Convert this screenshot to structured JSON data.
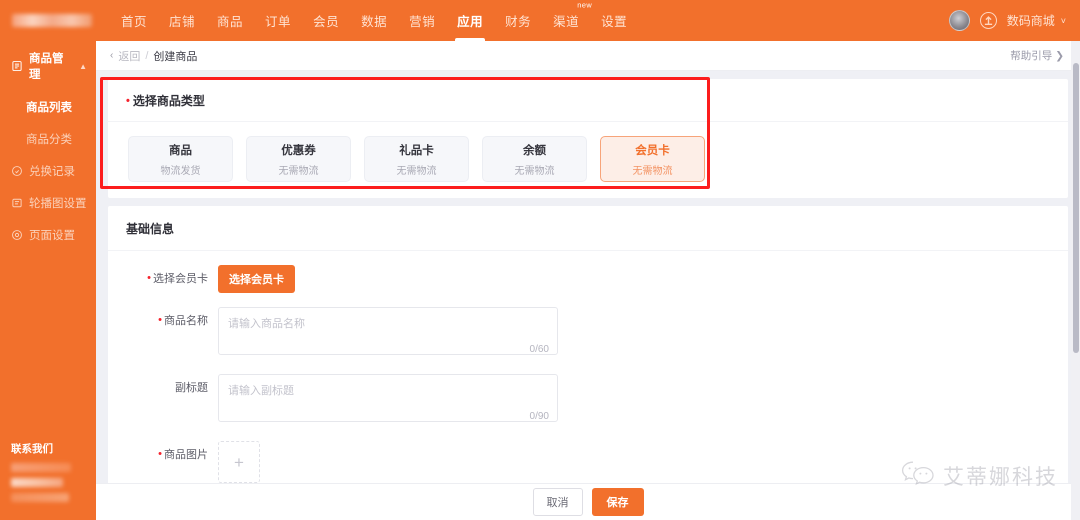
{
  "topbar": {
    "nav": [
      {
        "label": "首页",
        "active": false
      },
      {
        "label": "店铺",
        "active": false
      },
      {
        "label": "商品",
        "active": false
      },
      {
        "label": "订单",
        "active": false
      },
      {
        "label": "会员",
        "active": false
      },
      {
        "label": "数据",
        "active": false
      },
      {
        "label": "营销",
        "active": false
      },
      {
        "label": "应用",
        "active": true
      },
      {
        "label": "财务",
        "active": false
      },
      {
        "label": "渠道",
        "active": false,
        "badge": "new"
      },
      {
        "label": "设置",
        "active": false
      }
    ],
    "upload_icon": "upload-icon",
    "shop_name": "数码商城",
    "chevron": "˅",
    "accent_color": "#f2702c"
  },
  "sidebar": {
    "group": {
      "label": "商品管理",
      "icon": "clipboard-icon",
      "caret": "▲"
    },
    "items": [
      {
        "label": "商品列表",
        "icon": "",
        "active": true,
        "sub": true
      },
      {
        "label": "商品分类",
        "icon": "",
        "active": false,
        "sub": true
      },
      {
        "label": "兑换记录",
        "icon": "exchange-icon",
        "active": false,
        "sub": false
      },
      {
        "label": "轮播图设置",
        "icon": "carousel-icon",
        "active": false,
        "sub": false
      },
      {
        "label": "页面设置",
        "icon": "page-settings-icon",
        "active": false,
        "sub": false
      }
    ],
    "contact_title": "联系我们"
  },
  "breadcrumb": {
    "back_arrow": "‹",
    "back_label": "返回",
    "separator": "/",
    "current": "创建商品",
    "help_label": "帮助引导 ❯"
  },
  "product_type": {
    "title": "选择商品类型",
    "required_mark": "•",
    "cards": [
      {
        "title": "商品",
        "subtitle": "物流发货",
        "selected": false
      },
      {
        "title": "优惠券",
        "subtitle": "无需物流",
        "selected": false
      },
      {
        "title": "礼品卡",
        "subtitle": "无需物流",
        "selected": false
      },
      {
        "title": "余额",
        "subtitle": "无需物流",
        "selected": false
      },
      {
        "title": "会员卡",
        "subtitle": "无需物流",
        "selected": true
      }
    ],
    "annotation_color": "#fc1d1d"
  },
  "base_info": {
    "title": "基础信息",
    "fields": {
      "member_card": {
        "label": "选择会员卡",
        "required": true,
        "button_label": "选择会员卡"
      },
      "product_name": {
        "label": "商品名称",
        "required": true,
        "value": "",
        "placeholder": "请输入商品名称",
        "counter": "0/60"
      },
      "subtitle": {
        "label": "副标题",
        "required": false,
        "value": "",
        "placeholder": "请输入副标题",
        "counter": "0/90"
      },
      "product_image": {
        "label": "商品图片",
        "required": true,
        "add_icon": "plus-icon"
      }
    }
  },
  "footer": {
    "cancel_label": "取消",
    "save_label": "保存"
  },
  "watermark": {
    "icon": "wechat-bubbles-icon",
    "text": "艾蒂娜科技"
  }
}
